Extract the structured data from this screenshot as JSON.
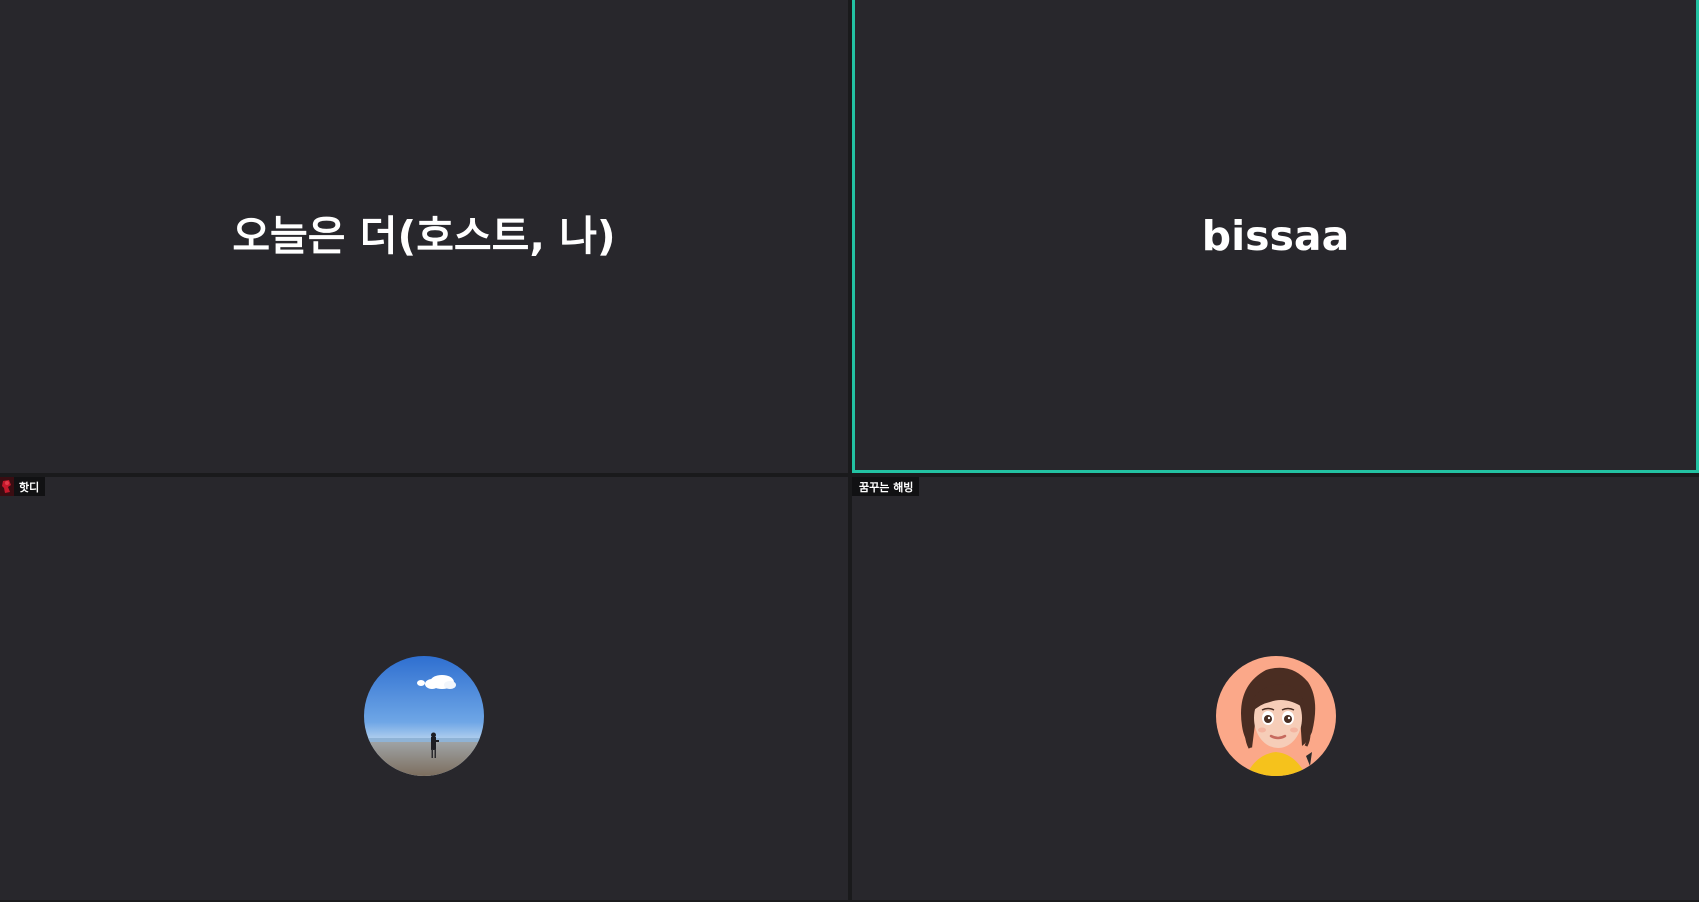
{
  "participants": [
    {
      "name": "오늘은 더(호스트, 나)",
      "video": "off",
      "active_speaker": false
    },
    {
      "name": "bissaa",
      "video": "off",
      "active_speaker": true
    },
    {
      "name": "핫디",
      "video": "off",
      "avatar_icon": "beach-photo-avatar",
      "tag_icon": "red-thumbnail-icon",
      "active_speaker": false
    },
    {
      "name": "꿈꾸는 해빙",
      "video": "off",
      "avatar_icon": "cartoon-girl-avatar",
      "active_speaker": false
    }
  ],
  "colors": {
    "tile_background": "#28272c",
    "active_speaker_border": "#23c2a3",
    "name_tag_background": "#111113",
    "text": "#ffffff"
  }
}
